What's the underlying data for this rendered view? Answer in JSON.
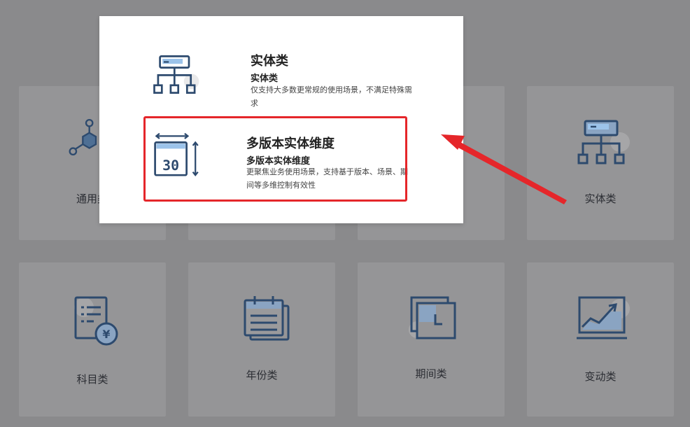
{
  "grid": {
    "cards": [
      {
        "id": "general",
        "label": "通用类"
      },
      {
        "id": "entity",
        "label": "实体类"
      },
      {
        "id": "subject",
        "label": "科目类"
      },
      {
        "id": "year",
        "label": "年份类"
      },
      {
        "id": "period",
        "label": "期间类"
      },
      {
        "id": "change",
        "label": "变动类"
      }
    ]
  },
  "modal": {
    "options": [
      {
        "title": "实体类",
        "subtitle": "实体类",
        "desc": "仅支持大多数更常规的使用场景，不满足特殊需求"
      },
      {
        "title": "多版本实体维度",
        "subtitle": "多版本实体维度",
        "desc": "更聚焦业务使用场景，支持基于版本、场景、期间等多维控制有效性",
        "icon_text": "30"
      }
    ]
  },
  "colors": {
    "icon_stroke": "#2d4a6e",
    "icon_fill": "#9cc3ea",
    "highlight": "#e5262a",
    "overlay": "#8a8a8c"
  }
}
